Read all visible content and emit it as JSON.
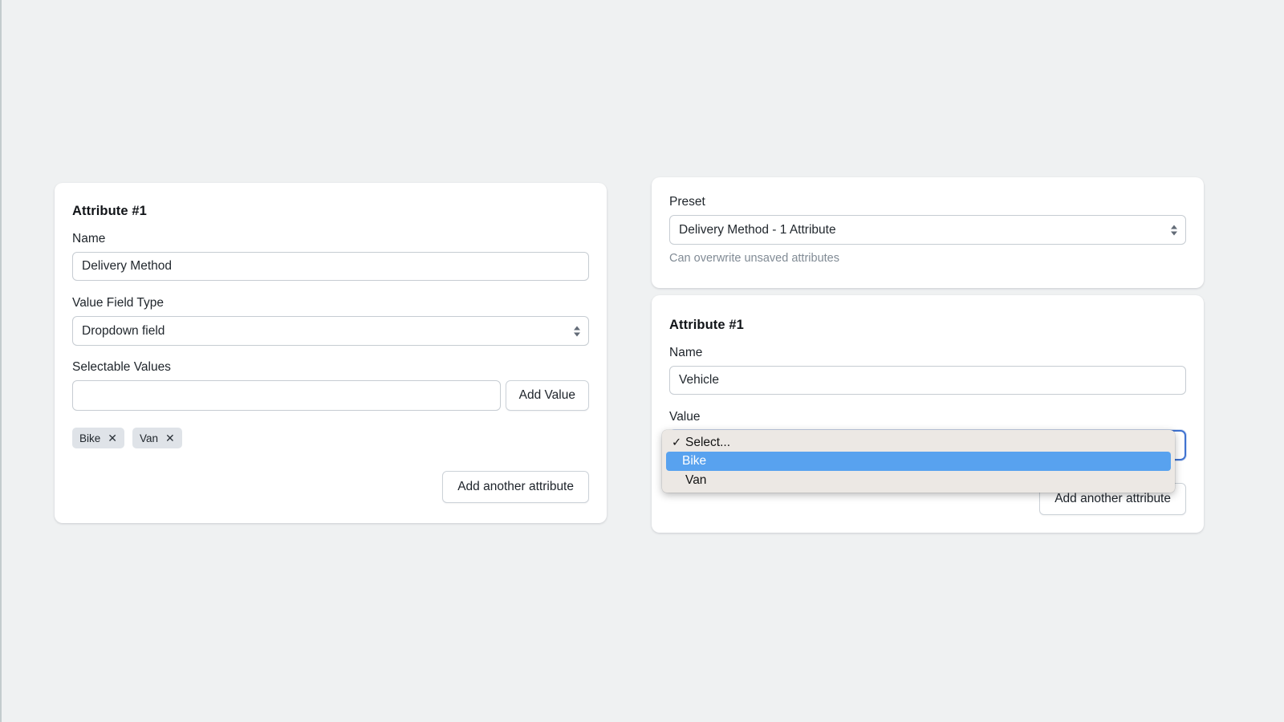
{
  "page": {
    "background_color": "#eff1f2"
  },
  "left_panel": {
    "card_title": "Attribute #1",
    "name_label": "Name",
    "name_value": "Delivery Method",
    "field_type_label": "Value Field Type",
    "field_type_value": "Dropdown field",
    "selectable_values_label": "Selectable Values",
    "new_value_input": "",
    "new_value_placeholder": "",
    "add_value_button": "Add Value",
    "tags": [
      {
        "label": "Bike",
        "remove_icon": "✕"
      },
      {
        "label": "Van",
        "remove_icon": "✕"
      }
    ],
    "add_attribute_button": "Add another attribute"
  },
  "preset_panel": {
    "preset_label": "Preset",
    "preset_value": "Delivery Method - 1 Attribute",
    "hint": "Can overwrite unsaved attributes"
  },
  "right_panel": {
    "card_title": "Attribute #1",
    "name_label": "Name",
    "name_value": "Vehicle",
    "value_label": "Value",
    "add_attribute_button": "Add another attribute"
  },
  "dropdown": {
    "open": true,
    "highlight_color": "#58a2ef",
    "background_color": "#ece8e4",
    "options": [
      {
        "label": "Select...",
        "checked": true,
        "highlighted": false,
        "check_icon": "✓"
      },
      {
        "label": "Bike",
        "checked": false,
        "highlighted": true,
        "check_icon": ""
      },
      {
        "label": "Van",
        "checked": false,
        "highlighted": false,
        "check_icon": ""
      }
    ]
  }
}
